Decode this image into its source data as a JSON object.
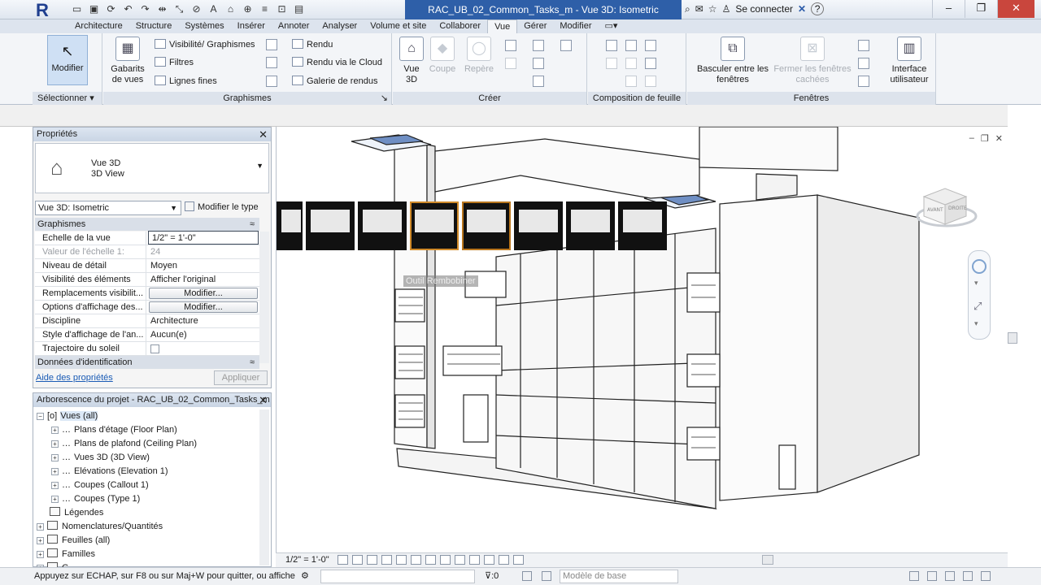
{
  "titlebar": {
    "doc_title": "RAC_UB_02_Common_Tasks_m - Vue 3D: Isometric",
    "signin": "Se connecter",
    "help": "?",
    "qat_icons": [
      "open-icon",
      "save-icon",
      "sync-icon",
      "undo-icon",
      "redo-icon",
      "measure-icon",
      "dimension-icon",
      "tag-icon",
      "text-icon",
      "3d-view-icon",
      "section-icon",
      "thin-lines-icon",
      "close-hidden-icon",
      "switch-windows-icon"
    ]
  },
  "tabs": [
    "Architecture",
    "Structure",
    "Systèmes",
    "Insérer",
    "Annoter",
    "Analyser",
    "Volume et site",
    "Collaborer",
    "Vue",
    "Gérer",
    "Modifier"
  ],
  "active_tab": "Vue",
  "ribbon": {
    "select": {
      "modify": "Modifier",
      "label": "Sélectionner"
    },
    "graphics": {
      "view_templates": "Gabarits de vues",
      "vis_graphics": "Visibilité/ Graphismes",
      "filters": "Filtres",
      "thin_lines": "Lignes fines",
      "render": "Rendu",
      "render_cloud": "Rendu  via le Cloud",
      "render_gallery": "Galerie  de rendus",
      "label": "Graphismes"
    },
    "create": {
      "view_3d": "Vue 3D",
      "section": "Coupe",
      "callout": "Repère",
      "label": "Créer"
    },
    "sheet": {
      "label": "Composition de feuille"
    },
    "windows": {
      "switch": "Basculer entre les fenêtres",
      "close_hidden": "Fermer les fenêtres cachées",
      "ui": "Interface utilisateur",
      "label": "Fenêtres"
    }
  },
  "properties": {
    "header": "Propriétés",
    "type_line1": "Vue 3D",
    "type_line2": "3D View",
    "view_combo": "Vue 3D: Isometric",
    "edit_type": "Modifier le type",
    "group1": "Graphismes",
    "rows": [
      {
        "k": "Echelle de la vue",
        "v": "1/2\" = 1'-0\""
      },
      {
        "k": "Valeur de l'échelle    1:",
        "v": "24"
      },
      {
        "k": "Niveau de détail",
        "v": "Moyen"
      },
      {
        "k": "Visibilité des éléments",
        "v": "Afficher l'original"
      },
      {
        "k": "Remplacements visibilit...",
        "v": "Modifier..."
      },
      {
        "k": "Options d'affichage des...",
        "v": "Modifier..."
      },
      {
        "k": "Discipline",
        "v": "Architecture"
      },
      {
        "k": "Style d'affichage de l'an...",
        "v": "Aucun(e)"
      },
      {
        "k": "Trajectoire du soleil",
        "v": ""
      }
    ],
    "group2": "Données d'identification",
    "help": "Aide des propriétés",
    "apply": "Appliquer"
  },
  "browser": {
    "header": "Arborescence du projet - RAC_UB_02_Common_Tasks_m",
    "items": [
      "Vues (all)",
      "Plans d'étage (Floor Plan)",
      "Plans de plafond (Ceiling Plan)",
      "Vues 3D (3D View)",
      "Elévations (Elevation 1)",
      "Coupes (Callout 1)",
      "Coupes (Type 1)",
      "Légendes",
      "Nomenclatures/Quantités",
      "Feuilles (all)",
      "Familles",
      "G"
    ]
  },
  "canvas": {
    "tooltip": "Outil Rembobiner",
    "viewcube_front": "AVANT",
    "viewcube_right": "DROITE",
    "thumb_count": 8,
    "selected_thumb": 2
  },
  "viewbar": {
    "scale": "1/2\" = 1'-0\""
  },
  "statusbar": {
    "message": "Appuyez sur ECHAP, sur F8 ou sur Maj+W pour quitter, ou affiche",
    "count": ":0",
    "model": "Modèle de base"
  }
}
